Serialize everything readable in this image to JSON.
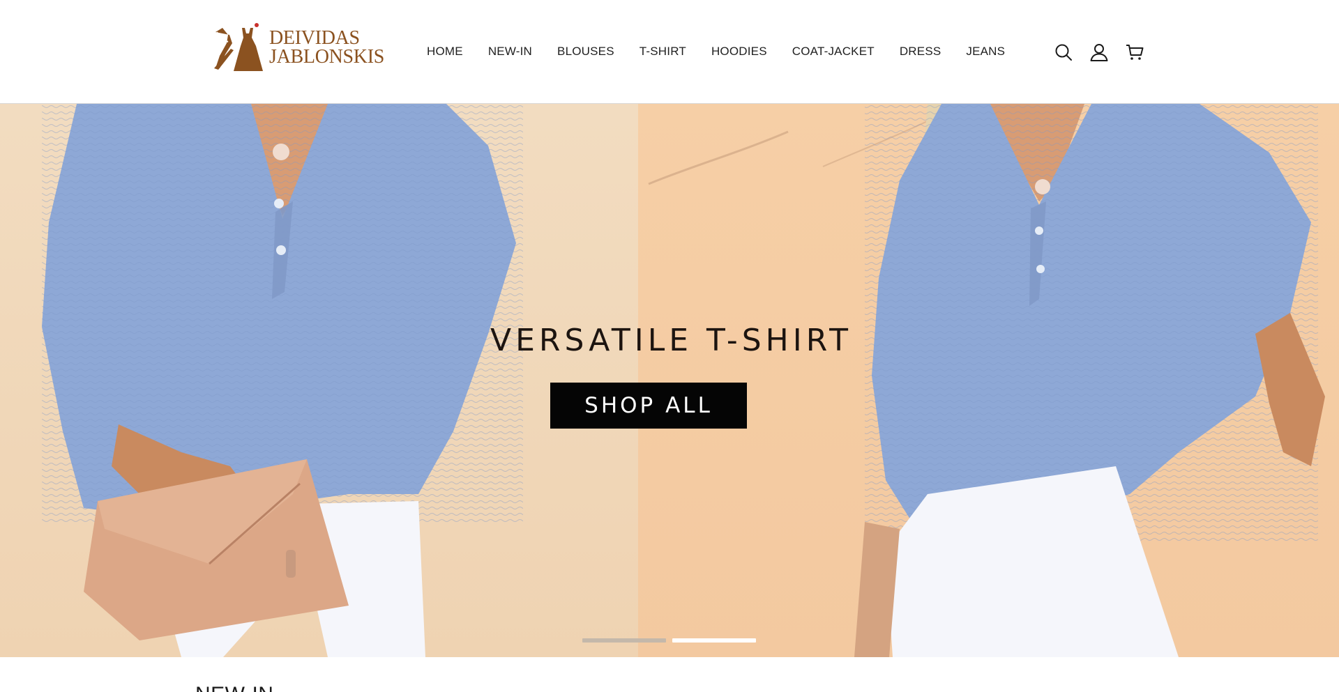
{
  "brand": {
    "line1": "DEIVIDAS",
    "line2": "JABLONSKIS",
    "color": "#8b5220",
    "accent": "#c9302c"
  },
  "nav": {
    "items": [
      {
        "label": "HOME"
      },
      {
        "label": "NEW-IN"
      },
      {
        "label": "BLOUSES"
      },
      {
        "label": "T-SHIRT"
      },
      {
        "label": "HOODIES"
      },
      {
        "label": "COAT-JACKET"
      },
      {
        "label": "DRESS"
      },
      {
        "label": "JEANS"
      }
    ]
  },
  "header_icons": [
    "search-icon",
    "account-icon",
    "cart-icon"
  ],
  "hero": {
    "title": "VERSATILE T-SHIRT",
    "cta_label": "SHOP ALL",
    "slide_count": 2,
    "active_slide": 2,
    "colors": {
      "background": "#f3d7b9",
      "shirt": "#8ea8d6",
      "cta": "#050505"
    }
  },
  "section": {
    "title": "NEW-IN"
  }
}
